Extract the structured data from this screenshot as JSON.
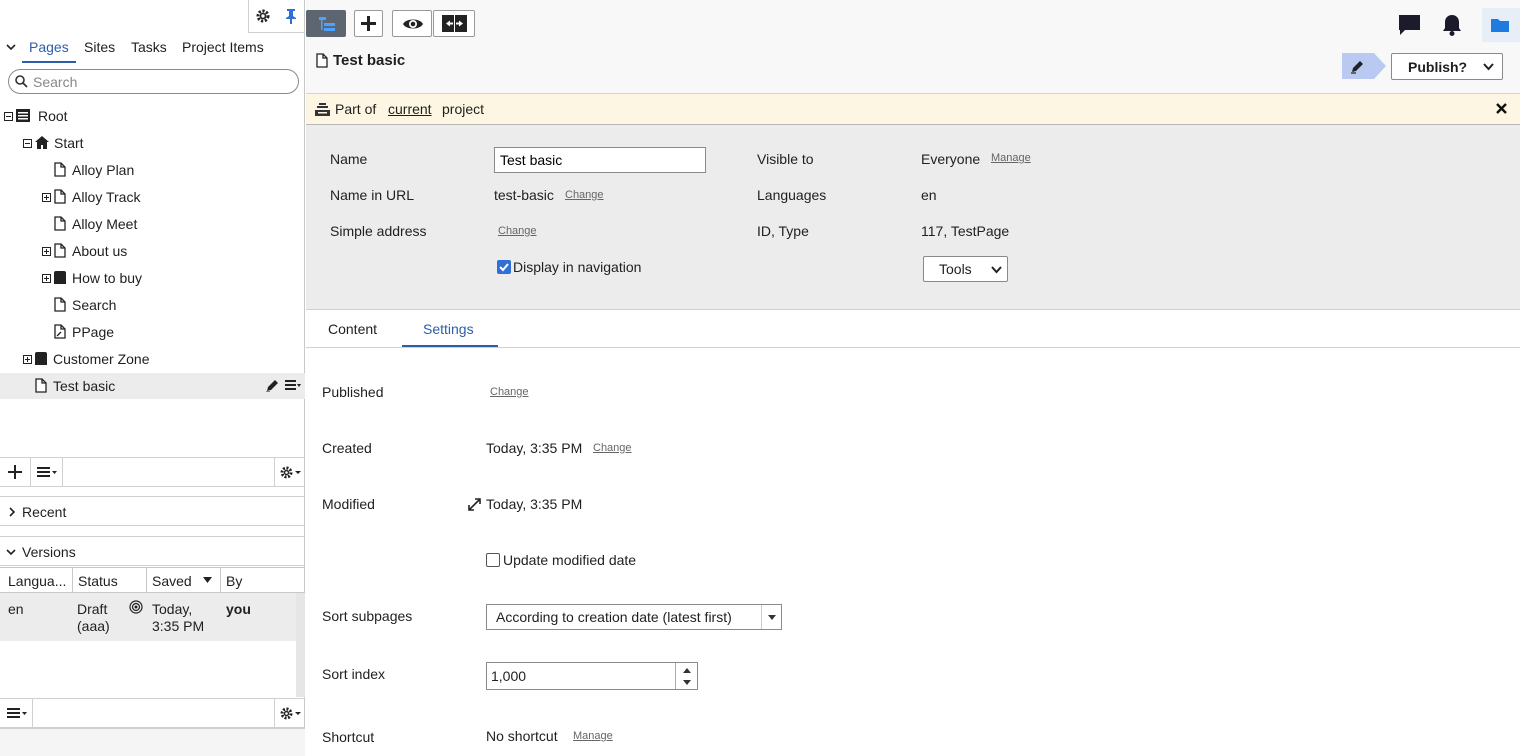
{
  "left": {
    "nav_tabs": [
      "Pages",
      "Sites",
      "Tasks",
      "Project Items"
    ],
    "search_placeholder": "Search",
    "tree": [
      {
        "label": "Root"
      },
      {
        "label": "Start"
      },
      {
        "label": "Alloy Plan"
      },
      {
        "label": "Alloy Track"
      },
      {
        "label": "Alloy Meet"
      },
      {
        "label": "About us"
      },
      {
        "label": "How to buy"
      },
      {
        "label": "Search"
      },
      {
        "label": "PPage"
      },
      {
        "label": "Customer Zone"
      },
      {
        "label": "Test basic"
      }
    ],
    "recent_label": "Recent",
    "versions_label": "Versions",
    "versions_columns": [
      "Langua...",
      "Status",
      "Saved",
      "By"
    ],
    "version_row": {
      "language": "en",
      "status_line1": "Draft",
      "status_line2": "(aaa)",
      "saved_line1": "Today,",
      "saved_line2": "3:35 PM",
      "by": "you"
    }
  },
  "header": {
    "page_title": "Test basic",
    "publish_label": "Publish?",
    "notice": {
      "prefix": "Part of",
      "link": "current",
      "suffix": "project"
    }
  },
  "props": {
    "name_label": "Name",
    "name_value": "Test basic",
    "name_in_url_label": "Name in URL",
    "name_in_url_value": "test-basic",
    "change": "Change",
    "simple_address_label": "Simple address",
    "display_in_nav_label": "Display in navigation",
    "visible_to_label": "Visible to",
    "visible_to_value": "Everyone",
    "manage": "Manage",
    "languages_label": "Languages",
    "languages_value": "en",
    "id_type_label": "ID, Type",
    "id_type_value": "117, TestPage",
    "tools_label": "Tools"
  },
  "content_tabs": [
    "Content",
    "Settings"
  ],
  "settings": {
    "published_label": "Published",
    "created_label": "Created",
    "created_value": "Today, 3:35 PM",
    "modified_label": "Modified",
    "modified_value": "Today, 3:35 PM",
    "update_modified_label": "Update modified date",
    "sort_subpages_label": "Sort subpages",
    "sort_subpages_value": "According to creation date (latest first)",
    "sort_index_label": "Sort index",
    "sort_index_value": "1,000",
    "shortcut_label": "Shortcut",
    "shortcut_value": "No shortcut"
  },
  "colors": {
    "accent": "#2d5fa8",
    "notice_bg": "#fdf6e3",
    "panel_bg": "#ececec",
    "checkbox": "#2f6fd6"
  }
}
